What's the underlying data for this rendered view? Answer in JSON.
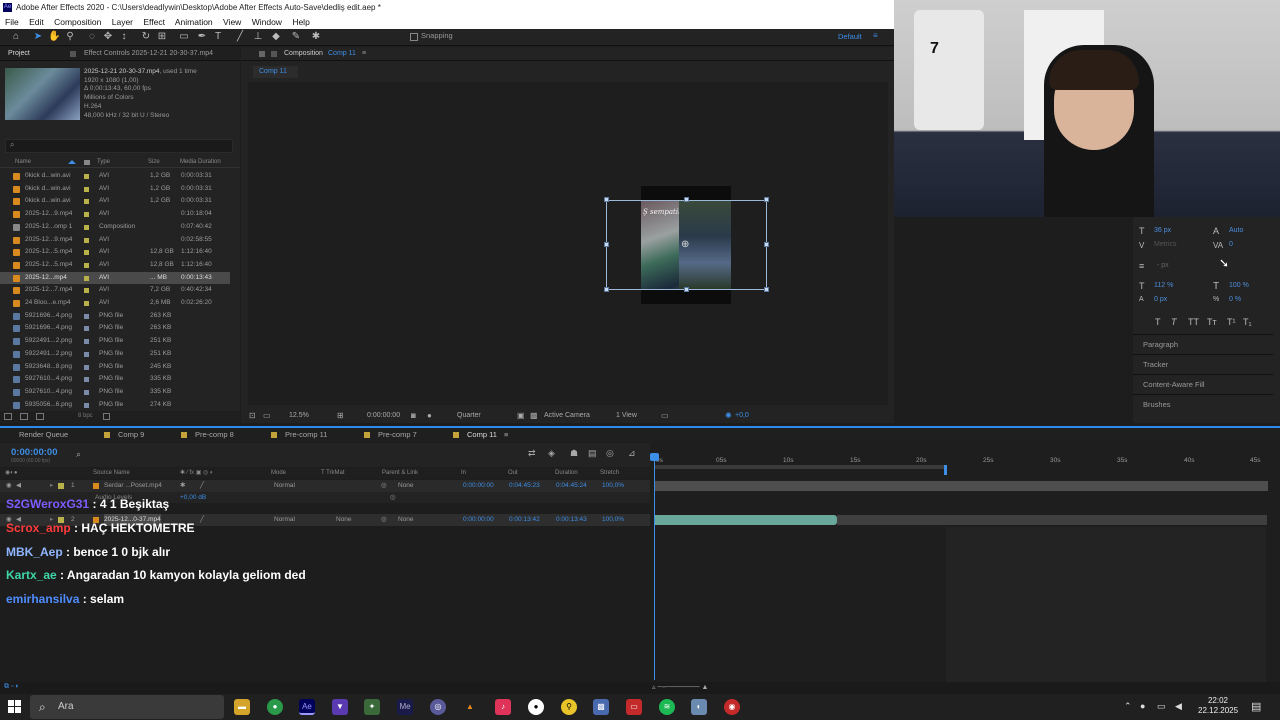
{
  "app": {
    "title": "Adobe After Effects 2020 - C:\\Users\\deadlywin\\Desktop\\Adobe After Effects Auto-Save\\dedliş edit.aep *",
    "logo": "Ae"
  },
  "menu": [
    "File",
    "Edit",
    "Composition",
    "Layer",
    "Effect",
    "Animation",
    "View",
    "Window",
    "Help"
  ],
  "toolbar": {
    "snapping": "Snapping",
    "workspace": "Default"
  },
  "project": {
    "tab_project": "Project",
    "tab_effect": "Effect Controls 2025-12-21 20-30-37.mp4",
    "info": {
      "name": "2025-12-21 20-30-37.mp4",
      "used": ", used 1 time",
      "line1": "1920 x 1080 (1,00)",
      "line2": "Δ 0;00:13:43, 60,00 fps",
      "line3": "Millions of Colors",
      "line4": "H.264",
      "line5": "48,000 kHz / 32 bit U / Stereo"
    },
    "search_icon": "⌕",
    "columns": {
      "name": "Name",
      "type": "Type",
      "size": "Size",
      "duration": "Media Duration"
    },
    "rows": [
      {
        "name": "0kick d...win.avi",
        "type": "AVI",
        "size": "1,2 GB",
        "dur": "0:00:03:31",
        "kind": "video"
      },
      {
        "name": "0kick d...win.avi",
        "type": "AVI",
        "size": "1,2 GB",
        "dur": "0:00:03:31",
        "kind": "video"
      },
      {
        "name": "0kick d...win.avi",
        "type": "AVI",
        "size": "1,2 GB",
        "dur": "0:00:03:31",
        "kind": "video"
      },
      {
        "name": "2025-12...9.mp4",
        "type": "AVI",
        "size": "",
        "dur": "0:10:18:04",
        "kind": "video"
      },
      {
        "name": "2025-12...omp 1",
        "type": "Composition",
        "size": "",
        "dur": "0:07:40:42",
        "kind": "comp"
      },
      {
        "name": "2025-12...9.mp4",
        "type": "AVI",
        "size": "",
        "dur": "0:02:58:55",
        "kind": "video"
      },
      {
        "name": "2025-12...5.mp4",
        "type": "AVI",
        "size": "12,8 GB",
        "dur": "1:12:16:40",
        "kind": "video"
      },
      {
        "name": "2025-12...5.mp4",
        "type": "AVI",
        "size": "12,8 GB",
        "dur": "1:12:16:40",
        "kind": "video"
      },
      {
        "name": "2025-12...mp4",
        "type": "AVI",
        "size": "... MB",
        "dur": "0:00:13:43",
        "kind": "video",
        "selected": true
      },
      {
        "name": "2025-12...7.mp4",
        "type": "AVI",
        "size": "7,2 GB",
        "dur": "0:40:42:34",
        "kind": "video"
      },
      {
        "name": "24 Bloo...e.mp4",
        "type": "AVI",
        "size": "2,6 MB",
        "dur": "0:02:26:20",
        "kind": "video"
      },
      {
        "name": "5921696...4.png",
        "type": "PNG file",
        "size": "263 KB",
        "dur": "",
        "kind": "img"
      },
      {
        "name": "5921696...4.png",
        "type": "PNG file",
        "size": "263 KB",
        "dur": "",
        "kind": "img"
      },
      {
        "name": "5922491...2.png",
        "type": "PNG file",
        "size": "251 KB",
        "dur": "",
        "kind": "img"
      },
      {
        "name": "5922491...2.png",
        "type": "PNG file",
        "size": "251 KB",
        "dur": "",
        "kind": "img"
      },
      {
        "name": "5923648...8.png",
        "type": "PNG file",
        "size": "245 KB",
        "dur": "",
        "kind": "img"
      },
      {
        "name": "5927610...4.png",
        "type": "PNG file",
        "size": "335 KB",
        "dur": "",
        "kind": "img"
      },
      {
        "name": "5927610...4.png",
        "type": "PNG file",
        "size": "335 KB",
        "dur": "",
        "kind": "img"
      },
      {
        "name": "5935056...6.png",
        "type": "PNG file",
        "size": "274 KB",
        "dur": "",
        "kind": "img"
      }
    ],
    "footer_bpc": "8 bpc"
  },
  "composition": {
    "tab_label": "Composition",
    "tab_comp": "Comp 11",
    "breadcrumb": "Comp 11",
    "overlay_text": "Ş sempatik adamı",
    "viewbar": {
      "zoom": "12.5%",
      "time": "0:00:00:00",
      "resolution": "Quarter",
      "camera": "Active Camera",
      "views": "1 View",
      "exposure": "+0,0"
    }
  },
  "character": {
    "font_size": "36 px",
    "leading": "Auto",
    "kerning": "Metrics",
    "tracking": "0",
    "stroke": "- px",
    "vscale": "112 %",
    "hscale": "100 %",
    "baseline": "0 px",
    "tsume": "0 %",
    "styles": [
      "T",
      "T",
      "TT",
      "Tт",
      "T¹",
      "T₁"
    ]
  },
  "panels": [
    "Paragraph",
    "Tracker",
    "Content-Aware Fill",
    "Brushes"
  ],
  "timeline": {
    "tabs": [
      "Render Queue",
      "Comp 9",
      "Pre-comp 8",
      "Pre-comp 11",
      "Pre-comp 7",
      "Comp 11"
    ],
    "timecode": "0:00:00:00",
    "timecode_sub": "00000 (60.00 fps)",
    "columns": {
      "source": "Source Name",
      "mode": "Mode",
      "trkmat": "T TrkMat",
      "parent": "Parent & Link",
      "in": "In",
      "out": "Out",
      "duration": "Duration",
      "stretch": "Stretch"
    },
    "layers": [
      {
        "num": "1",
        "name": "Serdar ...Poset.mp4",
        "mode": "Normal",
        "trkmat": "",
        "parent": "None",
        "in": "0:00:00:00",
        "out": "0:04:45:23",
        "dur": "0:04:45:24",
        "stretch": "100,0%"
      },
      {
        "num": "2",
        "name": "2025-12...0-37.mp4",
        "mode": "Normal",
        "trkmat": "None",
        "parent": "None",
        "in": "0:00:00:00",
        "out": "0:00:13:42",
        "dur": "0:00:13:43",
        "stretch": "100,0%"
      }
    ],
    "sublayer": "Audio Levels",
    "sublayer_val": "+0,00 dB",
    "ruler": [
      "0s",
      "05s",
      "10s",
      "15s",
      "20s",
      "25s",
      "30s",
      "35s",
      "40s",
      "45s"
    ]
  },
  "chat": [
    {
      "user": "S2GWeroxG31",
      "msg": ": 4 1 Beşiktaş",
      "color": "#7f5cff"
    },
    {
      "user": "Scrox_amp",
      "msg": ": HAÇ HEKTOMETRE",
      "color": "#ff3c3c"
    },
    {
      "user": "MBK_Aep",
      "msg": ": bence 1 0 bjk alır",
      "color": "#8fb6ff"
    },
    {
      "user": "Kartx_ae",
      "msg": ": Angaradan 10 kamyon kolayla geliom ded",
      "color": "#3fd6a8"
    },
    {
      "user": "emirhansilva",
      "msg": ": selam",
      "color": "#4f8dff"
    }
  ],
  "taskbar": {
    "search": "Ara",
    "time": "22:02",
    "date": "22.12.2025"
  }
}
